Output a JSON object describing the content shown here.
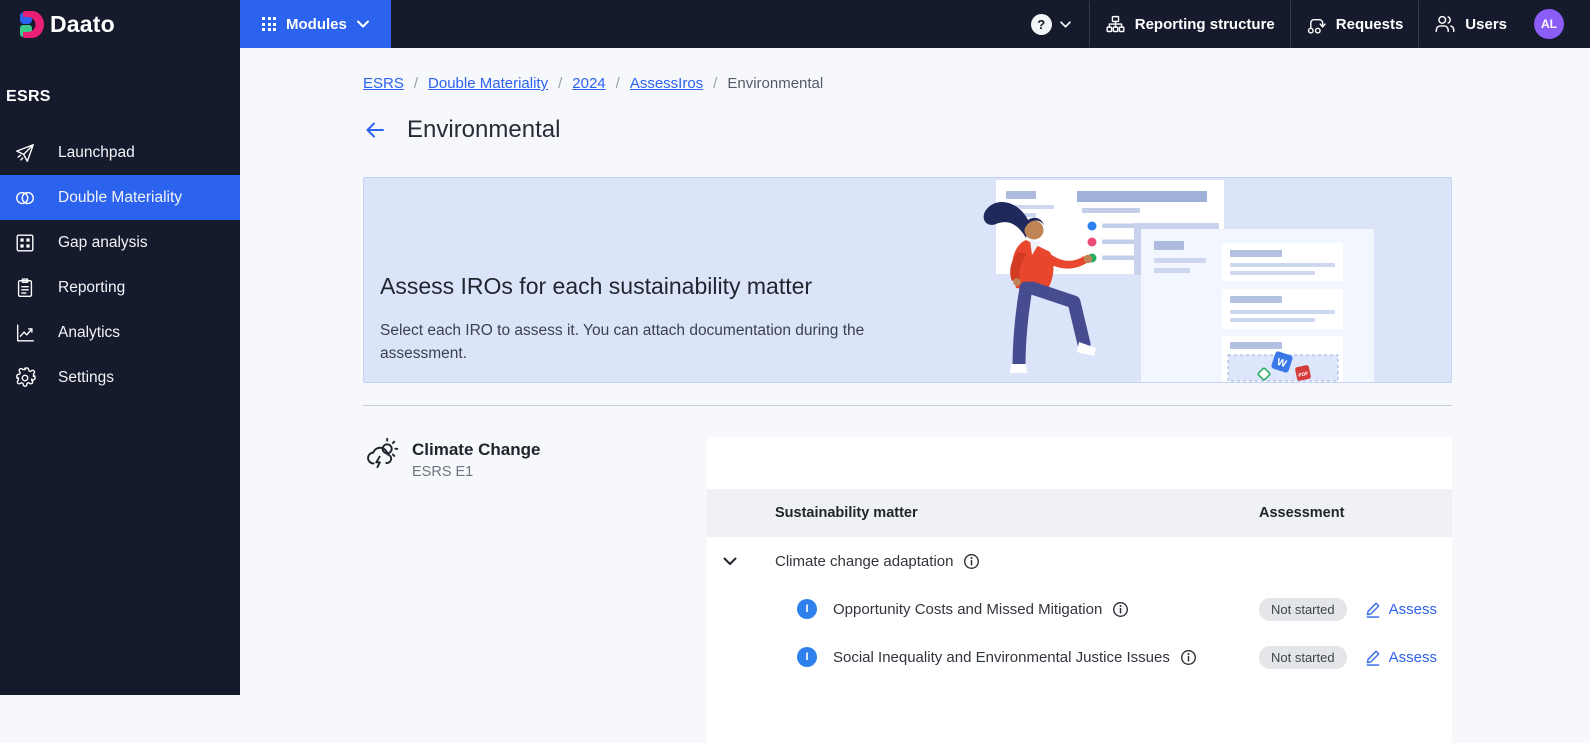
{
  "topbar": {
    "logo_text": "Daato",
    "modules_label": "Modules",
    "help_glyph": "?",
    "nav": [
      {
        "label": "Reporting structure",
        "icon": "sitemap-icon"
      },
      {
        "label": "Requests",
        "icon": "workflow-icon"
      },
      {
        "label": "Users",
        "icon": "users-icon"
      }
    ],
    "avatar_initials": "AL"
  },
  "sidebar": {
    "section_label": "ESRS",
    "items": [
      {
        "label": "Launchpad",
        "icon": "paper-plane-icon",
        "active": false
      },
      {
        "label": "Double Materiality",
        "icon": "venn-circles-icon",
        "active": true
      },
      {
        "label": "Gap analysis",
        "icon": "grid-panels-icon",
        "active": false
      },
      {
        "label": "Reporting",
        "icon": "clipboard-icon",
        "active": false
      },
      {
        "label": "Analytics",
        "icon": "trend-chart-icon",
        "active": false
      },
      {
        "label": "Settings",
        "icon": "gear-icon",
        "active": false
      }
    ]
  },
  "breadcrumb": {
    "separator": "/",
    "links": [
      "ESRS",
      "Double Materiality",
      "2024",
      "AssessIros"
    ],
    "current": "Environmental"
  },
  "page": {
    "title": "Environmental"
  },
  "banner": {
    "title": "Assess IROs for each sustainability matter",
    "subtitle": "Select each IRO to assess it. You can attach documentation during the assessment.",
    "illustration": {
      "word_file_label": "W",
      "pdf_file_label": "PDF"
    }
  },
  "section": {
    "title": "Climate Change",
    "subtitle": "ESRS E1",
    "icon": "storm-cloud-sun-icon"
  },
  "table": {
    "columns": {
      "matter": "Sustainability matter",
      "assessment": "Assessment"
    },
    "groups": [
      {
        "label": "Climate change adaptation",
        "expanded": true,
        "rows": [
          {
            "type_badge": "I",
            "label": "Opportunity Costs and Missed Mitigation",
            "status": "Not started",
            "action": "Assess"
          },
          {
            "type_badge": "I",
            "label": "Social Inequality and Environmental Justice Issues",
            "status": "Not started",
            "action": "Assess"
          }
        ]
      }
    ]
  },
  "colors": {
    "navy": "#151B2C",
    "accent_blue": "#2C63EE",
    "impact_badge_blue": "#2F80ED",
    "avatar_purple": "#8B5CF6",
    "banner_bg": "#DCE4FA",
    "page_bg": "#F7F8FB",
    "table_header_bg": "#F0F1F4",
    "status_badge_bg": "#E4E5E8"
  }
}
